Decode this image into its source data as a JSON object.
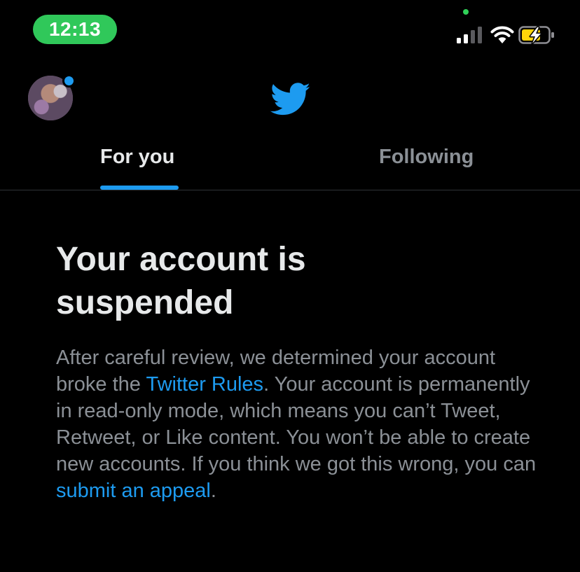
{
  "status_bar": {
    "time": "12:13",
    "time_pill_color": "#30c85a",
    "icons": [
      "cellular-signal-icon",
      "wifi-icon",
      "battery-charging-icon"
    ]
  },
  "header": {
    "avatar_icon": "profile-avatar",
    "logo_icon": "twitter-bird-logo",
    "tabs": [
      {
        "label": "For you",
        "active": true
      },
      {
        "label": "Following",
        "active": false
      }
    ]
  },
  "suspension": {
    "title": "Your account is suspended",
    "body_part1": "After careful review, we determined your account broke the ",
    "rules_link": "Twitter Rules",
    "body_part2": ". Your account is permanently in read-only mode, which means you can’t Tweet, Retweet, or Like content. You won’t be able to create new accounts. If you think we got this wrong, you can ",
    "appeal_link": "submit an appeal",
    "body_part3": "."
  },
  "colors": {
    "accent": "#1d9bf0",
    "background": "#000000",
    "primary_text": "#e7e9ea",
    "secondary_text": "#8b9096"
  }
}
